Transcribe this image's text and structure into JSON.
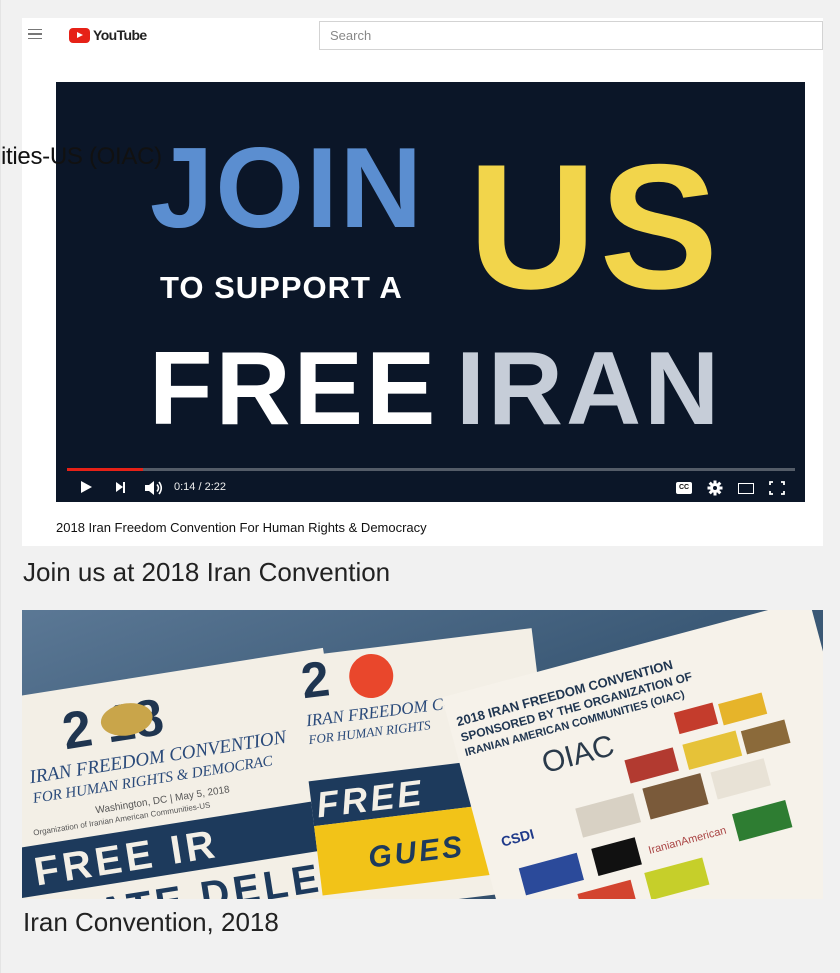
{
  "header": {
    "brand": "YouTube",
    "search_placeholder": "Search"
  },
  "video": {
    "thumbnail": {
      "line1": "JOIN",
      "line1_accent": "US",
      "line2": "TO SUPPORT A",
      "line3a": "FREE",
      "line3b": "IRAN"
    },
    "progress_fraction": 0.105,
    "time_display": "0:14 / 2:22",
    "cc_label": "CC",
    "title": "2018 Iran Freedom Convention For Human Rights & Democracy"
  },
  "overlay_text": "ities-US (OIAC)",
  "captions": {
    "first": "Join us at 2018 Iran Convention",
    "second": "Iran Convention, 2018"
  },
  "photo": {
    "card1_year": "2 18",
    "card1_title": "IRAN FREEDOM CONVENTION",
    "card1_subtitle": "FOR HUMAN RIGHTS & DEMOCRAC",
    "card1_place": "Washington, DC | May 5, 2018",
    "card1_org": "Organization of Iranian American Communities-US",
    "card1_badge1": "FREE IR",
    "card1_badge2": "STATE DELE",
    "card2_title": "IRAN FREEDOM CO",
    "card2_subtitle": "FOR HUMAN RIGHTS",
    "card2_badge1": "FREE",
    "card2_badge2": "GUES",
    "card3_line1": "2018 IRAN FREEDOM CONVENTION",
    "card3_line2": "SPONSORED BY THE ORGANIZATION OF",
    "card3_line3": "IRANIAN AMERICAN COMMUNITIES (OIAC)",
    "card3_logo": "OIAC",
    "card3_csdi": "CSDI",
    "card3_iranian_american": "IranianAmerican"
  },
  "colors": {
    "youtube_red": "#e62117",
    "thumb_blue": "#5b8ed0",
    "thumb_yellow": "#f2d54b",
    "thumb_background": "#0b1628"
  }
}
